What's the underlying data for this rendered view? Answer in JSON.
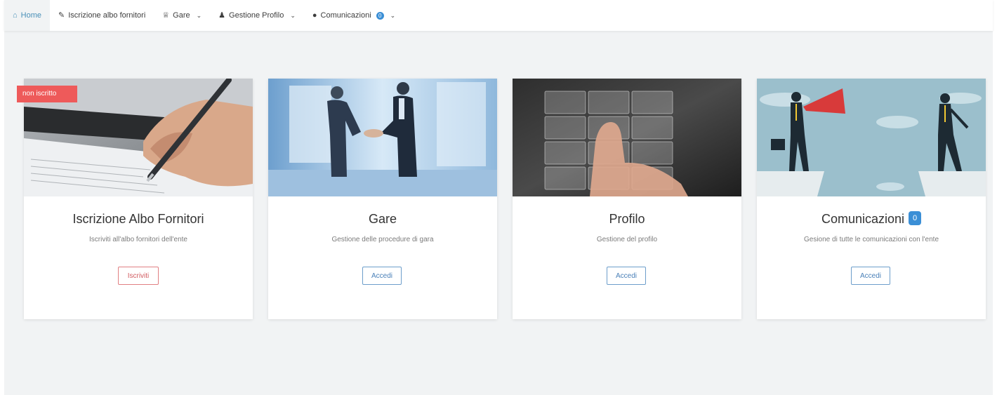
{
  "nav": {
    "items": [
      {
        "label": "Home",
        "icon": "home-icon",
        "glyph": "⌂",
        "active": true,
        "dropdown": false
      },
      {
        "label": "Iscrizione albo fornitori",
        "icon": "pencil-icon",
        "glyph": "✎",
        "active": false,
        "dropdown": false
      },
      {
        "label": "Gare",
        "icon": "trophy-icon",
        "glyph": "♕",
        "active": false,
        "dropdown": true
      },
      {
        "label": "Gestione Profilo",
        "icon": "user-icon",
        "glyph": "♟",
        "active": false,
        "dropdown": true
      },
      {
        "label": "Comunicazioni",
        "icon": "comments-icon",
        "glyph": "●",
        "active": false,
        "dropdown": true,
        "badge": "0"
      }
    ],
    "chevron": "⌵",
    "accent": "#4a90b8"
  },
  "cards": [
    {
      "title": "Iscrizione Albo Fornitori",
      "description": "Iscriviti all'albo fornitori dell'ente",
      "button": "Iscriviti",
      "ribbon": "non iscritto",
      "image": "signing-document-photo"
    },
    {
      "title": "Gare",
      "description": "Gestione delle procedure di gara",
      "button": "Accedi",
      "image": "handshake-photo"
    },
    {
      "title": "Profilo",
      "description": "Gestione del profilo",
      "button": "Accedi",
      "image": "touch-grid-photo"
    },
    {
      "title": "Comunicazioni",
      "title_badge": "0",
      "description": "Gesione di tutte le comunicazioni con l'ente",
      "button": "Accedi",
      "image": "megaphone-illustration"
    }
  ],
  "colors": {
    "background": "#f1f3f4",
    "badge": "#3b8fd6",
    "ribbon": "#ee5a5a",
    "button_blue": "#6d9ecb",
    "button_red": "#e17f82"
  }
}
